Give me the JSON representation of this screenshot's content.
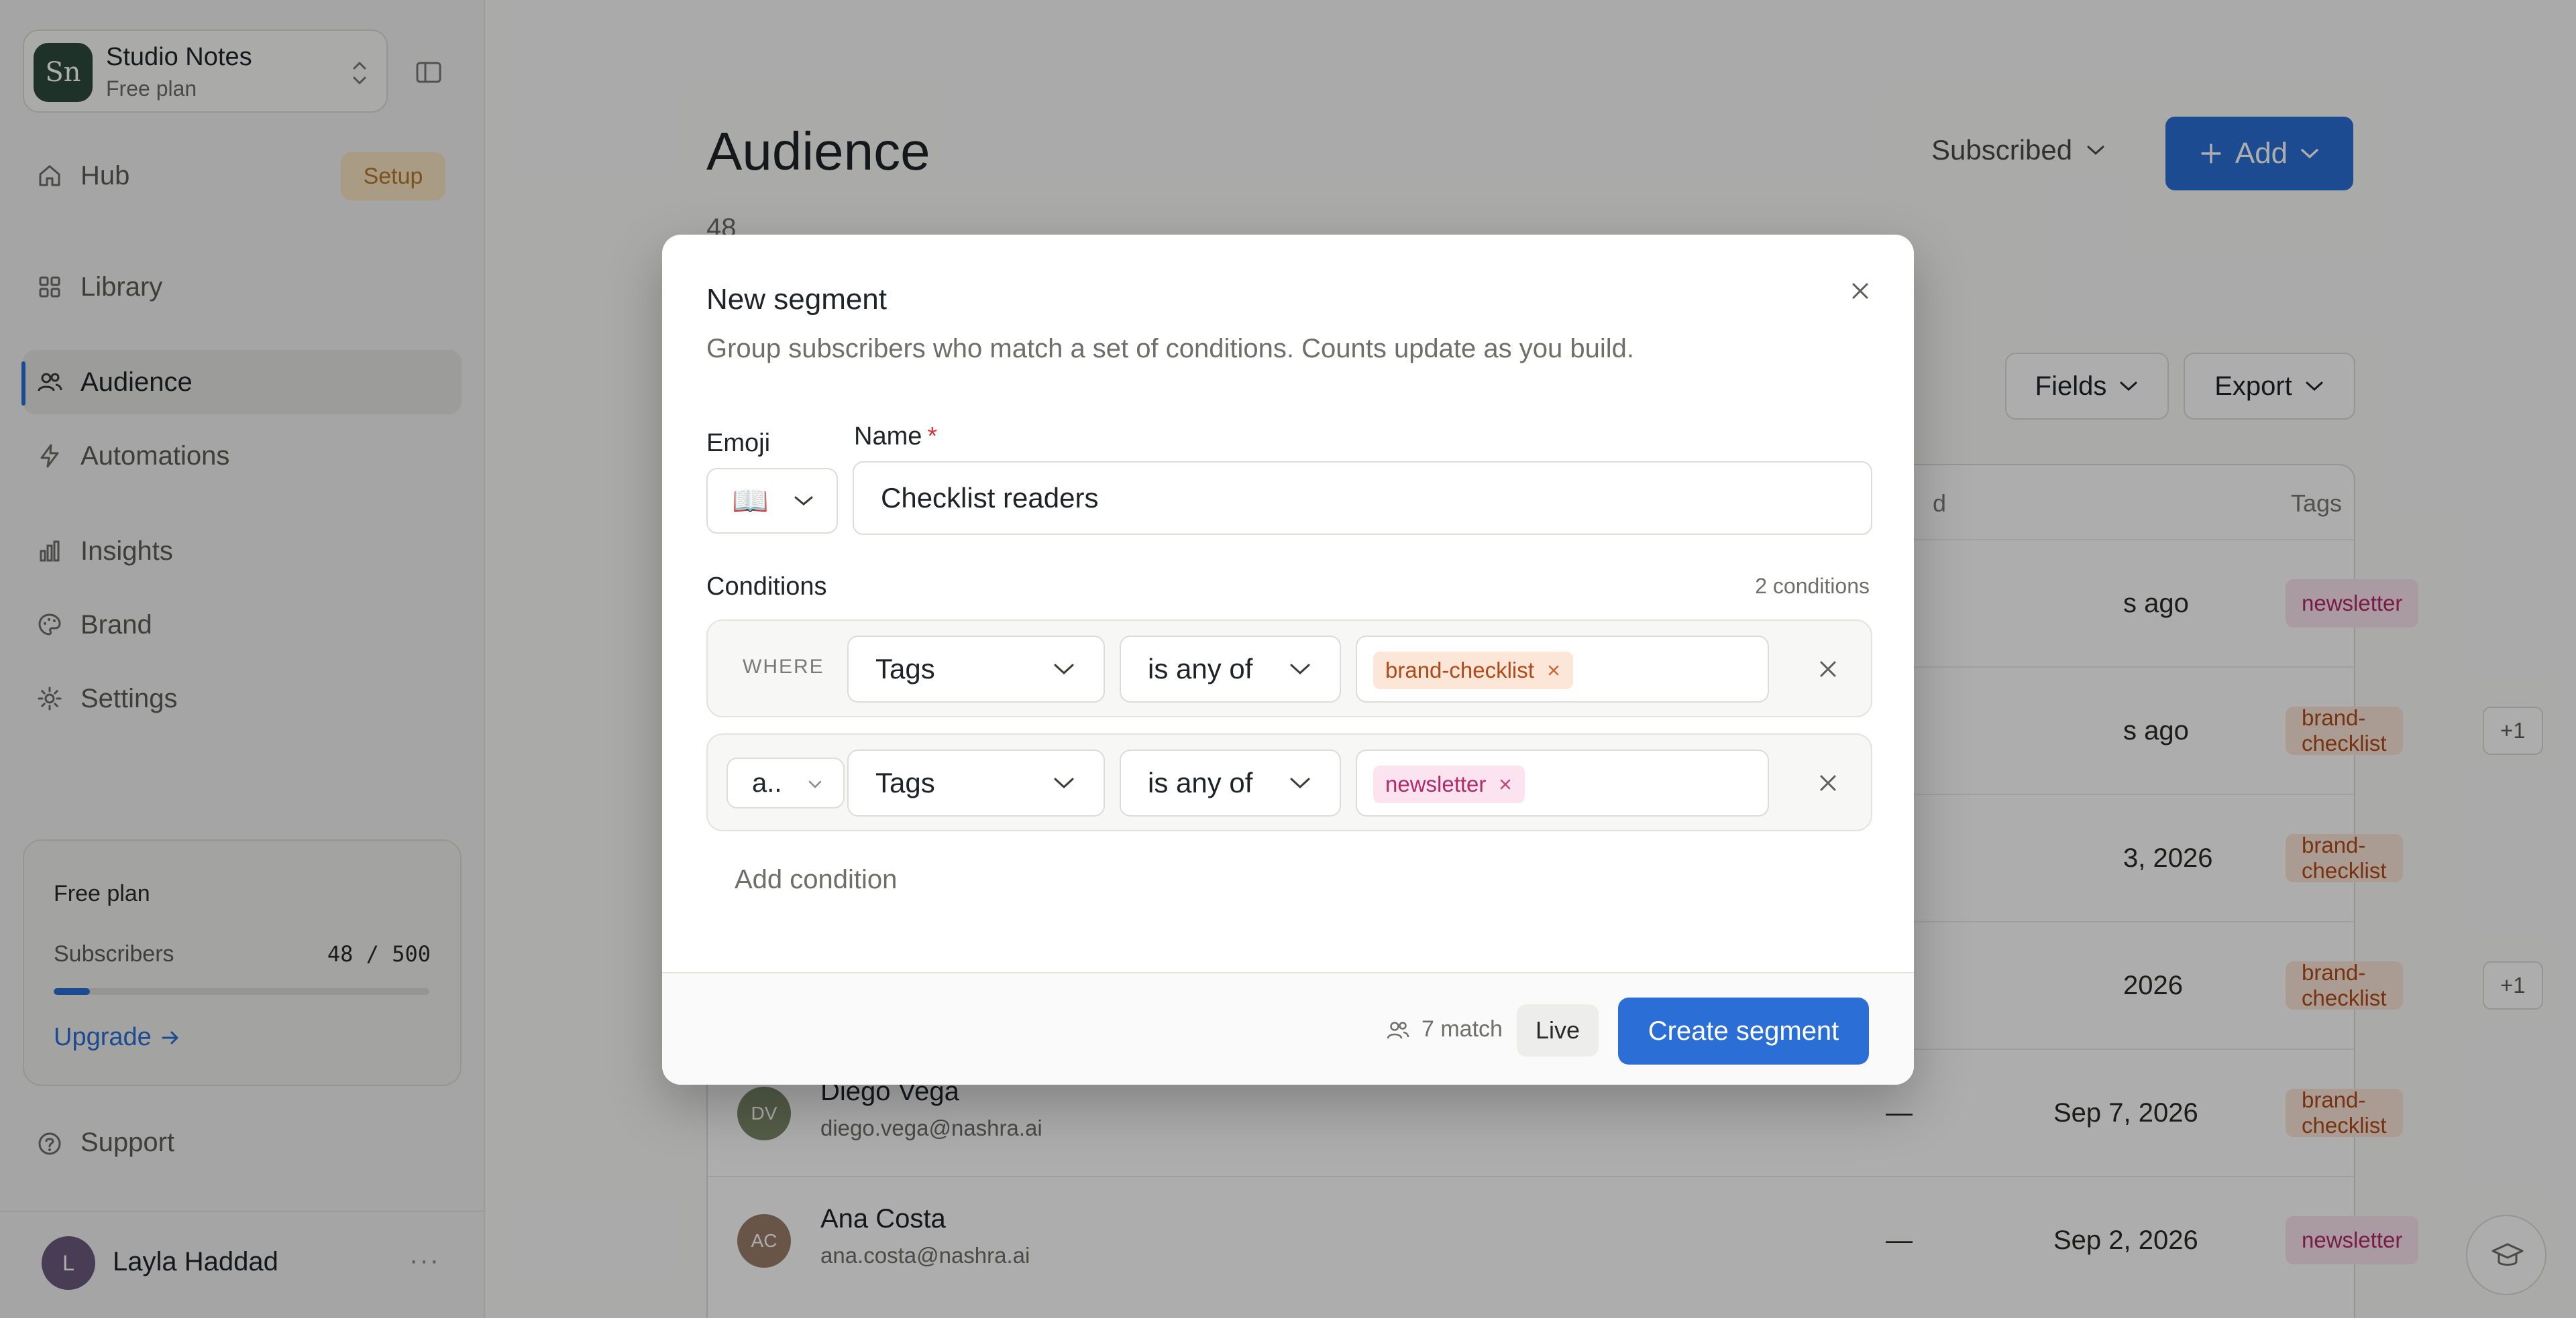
{
  "workspace": {
    "initials": "Sn",
    "name": "Studio Notes",
    "plan": "Free plan"
  },
  "sidebar": {
    "items": [
      {
        "label": "Hub",
        "icon": "home-icon",
        "badge": "Setup"
      },
      {
        "label": "Library",
        "icon": "grid-icon"
      },
      {
        "label": "Audience",
        "icon": "users-icon",
        "active": true
      },
      {
        "label": "Automations",
        "icon": "bolt-icon"
      },
      {
        "label": "Insights",
        "icon": "bar-chart-icon"
      },
      {
        "label": "Brand",
        "icon": "palette-icon"
      },
      {
        "label": "Settings",
        "icon": "gear-icon"
      }
    ],
    "plan_card": {
      "title": "Free plan",
      "subscribers_label": "Subscribers",
      "subscribers_count": "48 / 500",
      "usage_fraction": 0.096,
      "upgrade_label": "Upgrade"
    },
    "support_label": "Support",
    "user": {
      "initial": "L",
      "name": "Layla Haddad",
      "more": "···"
    }
  },
  "main": {
    "title": "Audience",
    "count": "48",
    "status_filter": "Subscribed",
    "add_label": "Add",
    "fields_label": "Fields",
    "export_label": "Export",
    "table": {
      "tags_header": "Tags",
      "partial_header": "d",
      "rows": [
        {
          "date": "s ago",
          "tags": [
            "newsletter"
          ],
          "extra": ""
        },
        {
          "date": "s ago",
          "tags": [
            "brand-checklist"
          ],
          "extra": "+1"
        },
        {
          "date": "3, 2026",
          "tags": [
            "brand-checklist"
          ],
          "extra": ""
        },
        {
          "date": "2026",
          "tags": [
            "brand-checklist"
          ],
          "extra": "+1"
        },
        {
          "initials": "DV",
          "name": "Diego Vega",
          "email": "diego.vega@nashra.ai",
          "dash": "—",
          "date": "Sep 7, 2026",
          "tags": [
            "brand-checklist"
          ],
          "extra": ""
        },
        {
          "initials": "AC",
          "name": "Ana Costa",
          "email": "ana.costa@nashra.ai",
          "dash": "—",
          "date": "Sep 2, 2026",
          "tags": [
            "newsletter"
          ],
          "extra": ""
        }
      ]
    }
  },
  "modal": {
    "title": "New segment",
    "subtitle": "Group subscribers who match a set of conditions. Counts update as you build.",
    "emoji_label": "Emoji",
    "emoji_value": "📖",
    "name_label": "Name",
    "name_required": "*",
    "name_value": "Checklist readers",
    "conditions_label": "Conditions",
    "conditions_count": "2 conditions",
    "conditions": [
      {
        "prefix": "WHERE",
        "field": "Tags",
        "operator": "is any of",
        "value": "brand-checklist"
      },
      {
        "prefix": "a..",
        "field": "Tags",
        "operator": "is any of",
        "value": "newsletter"
      }
    ],
    "add_condition": "Add condition",
    "match_text": "7 match",
    "live_label": "Live",
    "create_label": "Create segment"
  },
  "colors": {
    "accent": "#2b6fd6",
    "newsletter_tag": "#fbe3ef",
    "brand_tag": "#fbe6d8",
    "setup_badge": "#fbe5c4"
  }
}
